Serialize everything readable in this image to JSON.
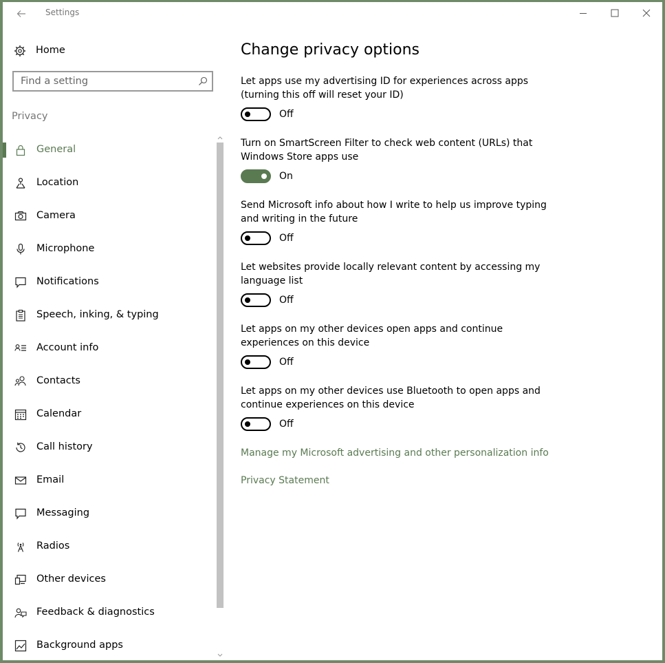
{
  "window": {
    "title": "Settings",
    "controls": [
      "minimize-icon",
      "maximize-icon",
      "close-icon"
    ]
  },
  "sidebar": {
    "home": {
      "label": "Home",
      "icon": "gear-icon"
    },
    "search": {
      "placeholder": "Find a setting",
      "icon": "search-icon"
    },
    "section_label": "Privacy",
    "items": [
      {
        "label": "General",
        "icon": "lock-icon",
        "selected": true
      },
      {
        "label": "Location",
        "icon": "location-icon"
      },
      {
        "label": "Camera",
        "icon": "camera-icon"
      },
      {
        "label": "Microphone",
        "icon": "microphone-icon"
      },
      {
        "label": "Notifications",
        "icon": "notification-icon"
      },
      {
        "label": "Speech, inking, & typing",
        "icon": "clipboard-icon"
      },
      {
        "label": "Account info",
        "icon": "account-info-icon"
      },
      {
        "label": "Contacts",
        "icon": "contacts-icon"
      },
      {
        "label": "Calendar",
        "icon": "calendar-icon"
      },
      {
        "label": "Call history",
        "icon": "history-icon"
      },
      {
        "label": "Email",
        "icon": "email-icon"
      },
      {
        "label": "Messaging",
        "icon": "message-icon"
      },
      {
        "label": "Radios",
        "icon": "radio-tower-icon"
      },
      {
        "label": "Other devices",
        "icon": "devices-icon"
      },
      {
        "label": "Feedback & diagnostics",
        "icon": "feedback-icon"
      },
      {
        "label": "Background apps",
        "icon": "background-apps-icon"
      }
    ]
  },
  "main": {
    "title": "Change privacy options",
    "settings": [
      {
        "description": "Let apps use my advertising ID for experiences across apps (turning this off will reset your ID)",
        "state": "Off",
        "on": false
      },
      {
        "description": "Turn on SmartScreen Filter to check web content (URLs) that Windows Store apps use",
        "state": "On",
        "on": true
      },
      {
        "description": "Send Microsoft info about how I write to help us improve typing and writing in the future",
        "state": "Off",
        "on": false
      },
      {
        "description": "Let websites provide locally relevant content by accessing my language list",
        "state": "Off",
        "on": false
      },
      {
        "description": "Let apps on my other devices open apps and continue experiences on this device",
        "state": "Off",
        "on": false
      },
      {
        "description": "Let apps on my other devices use Bluetooth to open apps and continue experiences on this device",
        "state": "Off",
        "on": false
      }
    ],
    "links": [
      "Manage my Microsoft advertising and other personalization info",
      "Privacy Statement"
    ]
  },
  "colors": {
    "accent": "#5a7a52",
    "window_frame": "#6e8a68",
    "secondary_text": "#767676",
    "scrollbar_thumb": "#c2c2c2"
  }
}
